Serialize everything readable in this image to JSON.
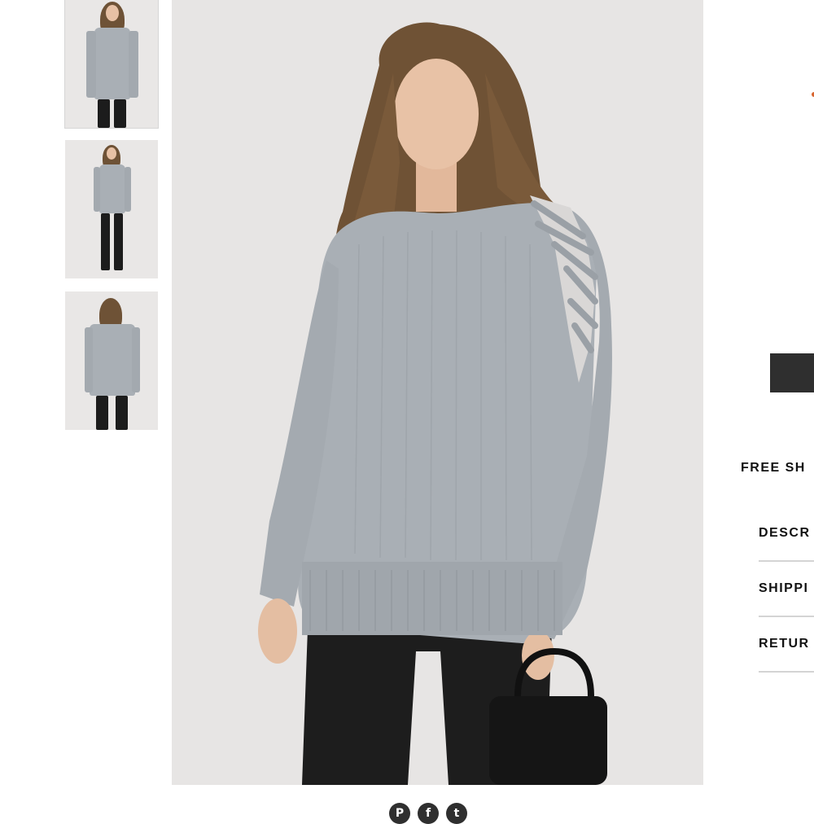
{
  "thumbnails": [
    {
      "alt": "front view",
      "active": true
    },
    {
      "alt": "full front view",
      "active": false
    },
    {
      "alt": "back view",
      "active": false
    }
  ],
  "share": {
    "icons": [
      "pinterest-icon",
      "facebook-icon",
      "twitter-icon"
    ],
    "glyphs": {
      "pinterest": "P",
      "facebook": "f",
      "twitter": "t"
    }
  },
  "right_panel": {
    "free_shipping": "FREE SH",
    "accordion": [
      "DESCR",
      "SHIPPI",
      "RETUR"
    ]
  },
  "colors": {
    "sweater": "#a9afb5",
    "background": "#e7e5e4",
    "button": "#2f2f2f",
    "accent": "#d8642e"
  }
}
